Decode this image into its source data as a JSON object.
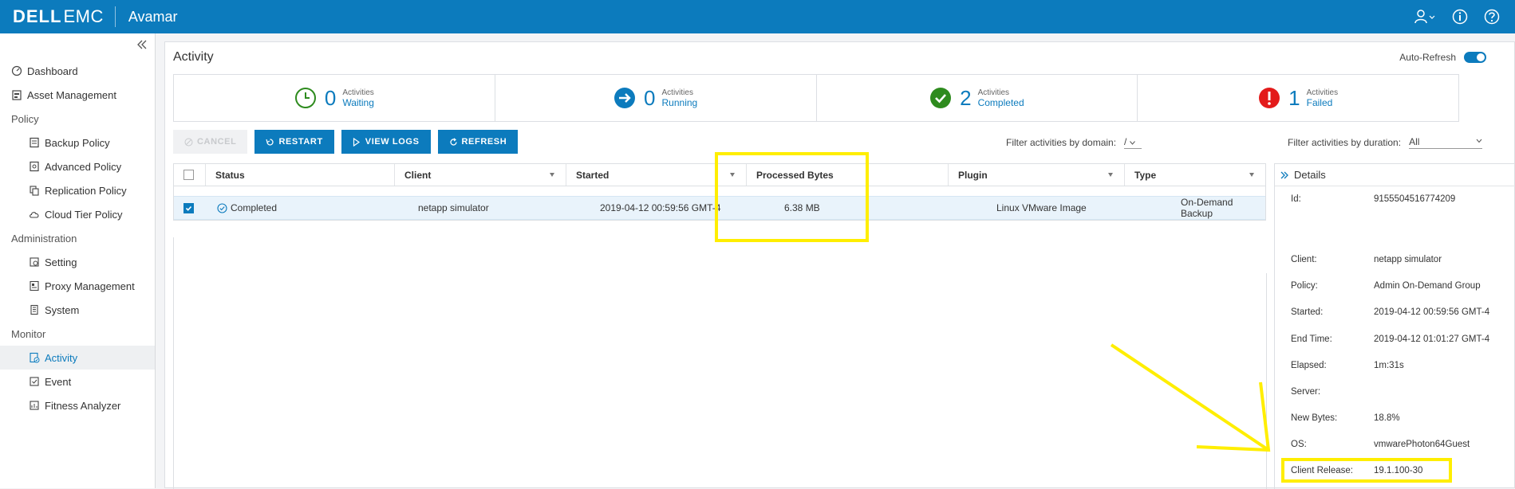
{
  "header": {
    "brand_dell": "DELL",
    "brand_emc": "EMC",
    "product": "Avamar",
    "icons": [
      "user-icon",
      "info-icon",
      "help-icon"
    ]
  },
  "sidebar": {
    "items": [
      {
        "label": "Dashboard",
        "icon": "dashboard-icon"
      },
      {
        "label": "Asset Management",
        "icon": "asset-icon"
      },
      {
        "label": "Policy",
        "section": true
      },
      {
        "label": "Backup Policy",
        "icon": "policy-icon"
      },
      {
        "label": "Advanced Policy",
        "icon": "advanced-policy-icon"
      },
      {
        "label": "Replication Policy",
        "icon": "replication-icon"
      },
      {
        "label": "Cloud Tier Policy",
        "icon": "cloud-icon"
      },
      {
        "label": "Administration",
        "section": true
      },
      {
        "label": "Setting",
        "icon": "gear-icon"
      },
      {
        "label": "Proxy Management",
        "icon": "proxy-icon"
      },
      {
        "label": "System",
        "icon": "server-icon"
      },
      {
        "label": "Monitor",
        "section": true
      },
      {
        "label": "Activity",
        "icon": "activity-icon",
        "active": true
      },
      {
        "label": "Event",
        "icon": "event-icon"
      },
      {
        "label": "Fitness Analyzer",
        "icon": "chart-icon"
      }
    ]
  },
  "main": {
    "title": "Activity",
    "auto_refresh_label": "Auto-Refresh",
    "stats": [
      {
        "count": "0",
        "small": "Activities",
        "big": "Waiting",
        "icon": "clock-icon",
        "color": "#2e8b1e"
      },
      {
        "count": "0",
        "small": "Activities",
        "big": "Running",
        "icon": "arrow-right-icon",
        "color": "#0c7bbd"
      },
      {
        "count": "2",
        "small": "Activities",
        "big": "Completed",
        "icon": "check-icon",
        "color": "#2e8b1e"
      },
      {
        "count": "1",
        "small": "Activities",
        "big": "Failed",
        "icon": "error-icon",
        "color": "#e31b1b"
      }
    ],
    "buttons": {
      "cancel": "CANCEL",
      "restart": "RESTART",
      "view_logs": "VIEW LOGS",
      "refresh": "REFRESH"
    },
    "filter_domain_label": "Filter activities by domain:",
    "filter_domain_value": "/",
    "filter_duration_label": "Filter activities by duration:",
    "filter_duration_value": "All"
  },
  "table": {
    "columns": [
      "Status",
      "Client",
      "Started",
      "Processed Bytes",
      "Plugin",
      "Type"
    ],
    "rows": [
      {
        "status": "Completed",
        "client": "netapp simulator",
        "started": "2019-04-12 00:59:56 GMT-4",
        "processed_bytes": "6.38 MB",
        "plugin": "Linux VMware Image",
        "type": "On-Demand Backup"
      }
    ]
  },
  "details": {
    "title": "Details",
    "fields": [
      {
        "label": "Id:",
        "value": "9155504516774209"
      },
      {
        "label": "Client:",
        "value": "netapp simulator"
      },
      {
        "label": "Policy:",
        "value": "Admin On-Demand Group"
      },
      {
        "label": "Started:",
        "value": "2019-04-12 00:59:56 GMT-4"
      },
      {
        "label": "End Time:",
        "value": "2019-04-12 01:01:27 GMT-4"
      },
      {
        "label": "Elapsed:",
        "value": "1m:31s"
      },
      {
        "label": "Server:",
        "value": ""
      },
      {
        "label": "New Bytes:",
        "value": "18.8%"
      },
      {
        "label": "OS:",
        "value": "vmwarePhoton64Guest"
      },
      {
        "label": "Client Release:",
        "value": "19.1.100-30"
      }
    ]
  },
  "colors": {
    "brand_blue": "#0c7bbd",
    "highlight": "#ffee00"
  }
}
